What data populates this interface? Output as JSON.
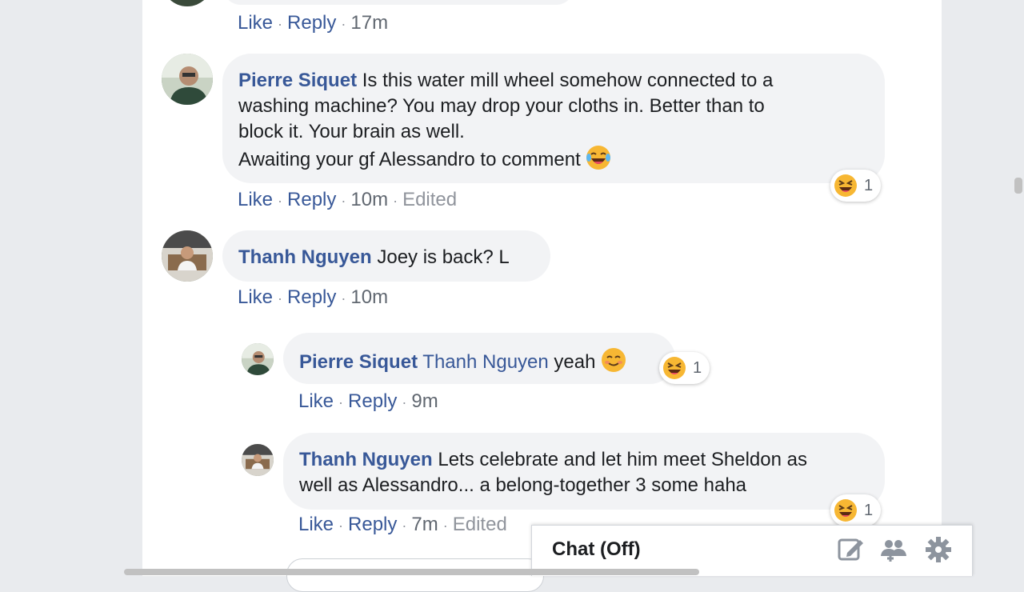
{
  "colors": {
    "link": "#385898",
    "bubble": "#f2f3f5",
    "muted": "#90949c",
    "page_bg": "#e9ebee"
  },
  "actions_labels": {
    "like": "Like",
    "reply": "Reply",
    "sep": "·"
  },
  "top_actions": {
    "time": "17m"
  },
  "comments": [
    {
      "author": "Pierre Siquet",
      "text_lines": [
        "Is this water mill wheel somehow connected to a",
        "washing machine? You may drop your cloths in. Better than to",
        "block it. Your brain as well.",
        "Awaiting your gf Alessandro to comment"
      ],
      "emoji": "tears-of-joy-emoji",
      "time": "10m",
      "edited": "Edited",
      "reaction": {
        "icon": "laughing-squint-emoji",
        "count": "1"
      }
    },
    {
      "author": "Thanh Nguyen",
      "text": "Joey is back? L",
      "time": "10m"
    }
  ],
  "replies": [
    {
      "author": "Pierre Siquet",
      "mention": "Thanh Nguyen",
      "text": "yeah",
      "emoji": "smiling-emoji",
      "time": "9m",
      "reaction": {
        "icon": "laughing-squint-emoji",
        "count": "1"
      }
    },
    {
      "author": "Thanh Nguyen",
      "text_lines": [
        "Lets celebrate and let him meet Sheldon as",
        "well as Alessandro... a belong-together 3 some haha"
      ],
      "time": "7m",
      "edited": "Edited",
      "reaction": {
        "icon": "laughing-squint-emoji",
        "count": "1"
      }
    }
  ],
  "chat": {
    "title": "Chat (Off)",
    "icons": [
      "compose-icon",
      "create-group-icon",
      "settings-gear-icon"
    ]
  }
}
